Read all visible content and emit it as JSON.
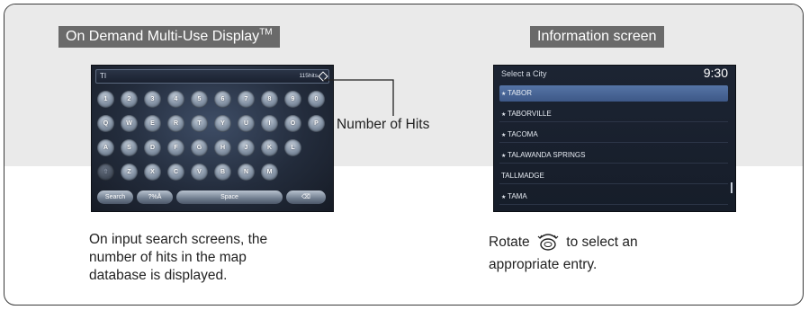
{
  "left_panel": {
    "title": "On Demand Multi-Use Display",
    "title_tm": "TM",
    "search_bar": {
      "typed_text": "TI",
      "hits_text": "115hits"
    },
    "keyboard_rows": [
      [
        "1",
        "2",
        "3",
        "4",
        "5",
        "6",
        "7",
        "8",
        "9",
        "0"
      ],
      [
        "Q",
        "W",
        "E",
        "R",
        "T",
        "Y",
        "U",
        "I",
        "O",
        "P"
      ],
      [
        "A",
        "S",
        "D",
        "F",
        "G",
        "H",
        "J",
        "K",
        "L"
      ],
      [
        "⇧",
        "Z",
        "X",
        "C",
        "V",
        "B",
        "N",
        "M"
      ]
    ],
    "bottom_keys": {
      "search": "Search",
      "symbols": "?%Å",
      "space": "Space",
      "backspace": "⌫"
    },
    "callout": "Number of Hits",
    "caption": [
      "On input search screens, the",
      "number of hits in the map",
      "database is displayed."
    ]
  },
  "right_panel": {
    "title": "Information screen",
    "header_text": "Select a City",
    "clock": "9:30",
    "cities": [
      "TABOR",
      "TABORVILLE",
      "TACOMA",
      "TALAWANDA SPRINGS",
      "TALLMADGE",
      "TAMA"
    ],
    "city_starred": [
      true,
      true,
      true,
      true,
      false,
      true
    ],
    "caption_before_icon": "Rotate",
    "caption_after_icon": "to select an",
    "caption_line2": "appropriate entry.",
    "dial_icon": "rotate-dial-icon"
  }
}
